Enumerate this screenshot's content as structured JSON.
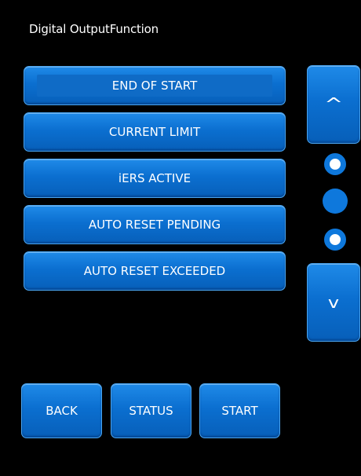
{
  "header": {
    "title": "Digital OutputFunction"
  },
  "options": [
    {
      "label": "END OF START",
      "selected": true
    },
    {
      "label": "CURRENT LIMIT",
      "selected": false
    },
    {
      "label": "iERS ACTIVE",
      "selected": false
    },
    {
      "label": "AUTO RESET PENDING",
      "selected": false
    },
    {
      "label": "AUTO RESET EXCEEDED",
      "selected": false
    }
  ],
  "scroll": {
    "up_label": "^",
    "down_label": "v",
    "page_indicators": [
      "page-dot-1",
      "page-dot-2",
      "page-dot-3"
    ],
    "current_page": 2
  },
  "footer": {
    "back_label": "BACK",
    "status_label": "STATUS",
    "start_label": "START"
  },
  "colors": {
    "background": "#000000",
    "button_blue": "#0b6fd0",
    "button_border": "#4aa6f2",
    "indicator": "#0e78dc",
    "text": "#ffffff"
  }
}
